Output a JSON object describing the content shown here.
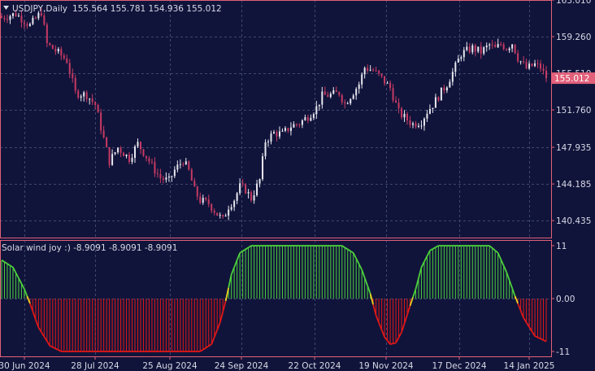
{
  "theme": {
    "bg": "#11143a",
    "frame": "#e2607a",
    "grid": "#3c4770",
    "text": "#d7d9e6",
    "bull": "#e8e8f0",
    "bear": "#c63a64",
    "price_badge": "#e2607a",
    "osc_pos": "#4cd03c",
    "osc_neg": "#e01818",
    "osc_mid": "#e8d020"
  },
  "header": {
    "symbol_label": "USDJPY,Daily",
    "ohlc_label": "155.564 155.781 154.936 155.012",
    "indicator_label": "Solar wind joy :) -8.9091 -8.9091 -8.9091"
  },
  "chart_data": [
    {
      "type": "candlestick",
      "title": "USDJPY,Daily",
      "ylim": [
        138.7,
        163.01
      ],
      "y_ticks": [
        "163.010",
        "159.260",
        "155.510",
        "151.760",
        "147.935",
        "144.185",
        "140.435"
      ],
      "y_tick_values": [
        163.01,
        159.26,
        155.51,
        151.76,
        147.935,
        144.185,
        140.435
      ],
      "last_price": 155.012,
      "last_price_label": "155.012",
      "x_ticks": [
        "30 Jun 2024",
        "28 Jul 2024",
        "25 Aug 2024",
        "24 Sep 2024",
        "22 Oct 2024",
        "19 Nov 2024",
        "17 Dec 2024",
        "14 Jan 2025"
      ],
      "close_path": [
        [
          0,
          161.2
        ],
        [
          5,
          161.6
        ],
        [
          10,
          160.4
        ],
        [
          14,
          161.8
        ],
        [
          16,
          158.5
        ],
        [
          20,
          157.6
        ],
        [
          23,
          156.8
        ],
        [
          26,
          153.5
        ],
        [
          30,
          153.3
        ],
        [
          33,
          152.3
        ],
        [
          36,
          148.8
        ],
        [
          38,
          146.5
        ],
        [
          41,
          147.9
        ],
        [
          45,
          146.8
        ],
        [
          48,
          148.3
        ],
        [
          51,
          147.0
        ],
        [
          54,
          145.6
        ],
        [
          56,
          144.8
        ],
        [
          59,
          144.5
        ],
        [
          61,
          145.6
        ],
        [
          64,
          146.6
        ],
        [
          66,
          145.5
        ],
        [
          68,
          143.5
        ],
        [
          70,
          142.5
        ],
        [
          73,
          142.2
        ],
        [
          76,
          141.1
        ],
        [
          78,
          140.5
        ],
        [
          80,
          141.9
        ],
        [
          82,
          142.6
        ],
        [
          84,
          143.9
        ],
        [
          86,
          143.6
        ],
        [
          88,
          142.7
        ],
        [
          91,
          144.6
        ],
        [
          93,
          148.6
        ],
        [
          96,
          149.4
        ],
        [
          99,
          149.3
        ],
        [
          102,
          150.1
        ],
        [
          105,
          150.4
        ],
        [
          108,
          151.1
        ],
        [
          111,
          152.0
        ],
        [
          113,
          153.2
        ],
        [
          116,
          153.3
        ],
        [
          119,
          153.5
        ],
        [
          121,
          152.4
        ],
        [
          123,
          153.2
        ],
        [
          126,
          154.4
        ],
        [
          128,
          156.1
        ],
        [
          131,
          155.8
        ],
        [
          134,
          155.0
        ],
        [
          137,
          154.0
        ],
        [
          140,
          151.5
        ],
        [
          142,
          151.0
        ],
        [
          145,
          150.3
        ],
        [
          148,
          150.6
        ],
        [
          150,
          151.6
        ],
        [
          152,
          152.3
        ],
        [
          155,
          153.6
        ],
        [
          157,
          154.4
        ],
        [
          160,
          156.2
        ],
        [
          162,
          157.5
        ],
        [
          164,
          157.8
        ],
        [
          166,
          158.1
        ],
        [
          169,
          157.7
        ],
        [
          172,
          158.4
        ],
        [
          174,
          158.0
        ],
        [
          176,
          158.5
        ],
        [
          178,
          158.1
        ],
        [
          180,
          158.6
        ],
        [
          182,
          157.1
        ],
        [
          185,
          156.0
        ],
        [
          188,
          156.4
        ],
        [
          190,
          156.1
        ],
        [
          192,
          155.0
        ]
      ],
      "candle_count": 193
    },
    {
      "type": "histogram",
      "title": "Solar wind joy :)",
      "ylim": [
        -11,
        11
      ],
      "y_ticks": [
        "11",
        "0.00",
        "-11"
      ],
      "y_tick_values": [
        11,
        0,
        -11
      ],
      "last_value": -8.9091,
      "values_path": [
        [
          0,
          8.0
        ],
        [
          4,
          6.5
        ],
        [
          8,
          2.0
        ],
        [
          10,
          -1.0
        ],
        [
          13,
          -6.0
        ],
        [
          17,
          -9.8
        ],
        [
          21,
          -11.0
        ],
        [
          70,
          -11.0
        ],
        [
          74,
          -9.5
        ],
        [
          77,
          -5.0
        ],
        [
          79,
          -0.5
        ],
        [
          81,
          5.0
        ],
        [
          84,
          9.5
        ],
        [
          88,
          11.0
        ],
        [
          120,
          11.0
        ],
        [
          124,
          9.5
        ],
        [
          127,
          6.0
        ],
        [
          130,
          1.0
        ],
        [
          132,
          -3.5
        ],
        [
          135,
          -8.0
        ],
        [
          137,
          -9.5
        ],
        [
          139,
          -9.2
        ],
        [
          141,
          -7.0
        ],
        [
          144,
          -1.5
        ],
        [
          146,
          2.0
        ],
        [
          148,
          6.5
        ],
        [
          151,
          10.0
        ],
        [
          154,
          11.0
        ],
        [
          172,
          11.0
        ],
        [
          175,
          9.5
        ],
        [
          178,
          5.5
        ],
        [
          181,
          0.5
        ],
        [
          184,
          -4.0
        ],
        [
          188,
          -7.8
        ],
        [
          192,
          -8.9091
        ]
      ]
    }
  ]
}
